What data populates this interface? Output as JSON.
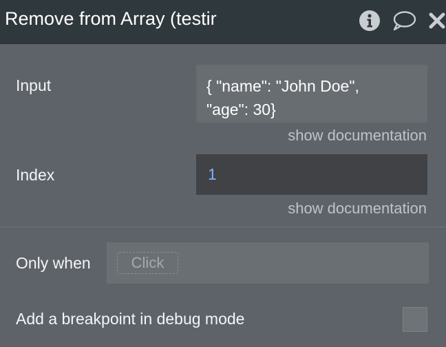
{
  "window": {
    "title": "Remove from Array (testir"
  },
  "icons": {
    "info": "info-icon",
    "comment": "comment-icon",
    "close": "close-icon"
  },
  "fields": {
    "input": {
      "label": "Input",
      "value_line1": "{ \"name\": \"John Doe\",",
      "value_line2": "\"age\": 30}",
      "doc_link": "show documentation"
    },
    "index": {
      "label": "Index",
      "value": "1",
      "doc_link": "show documentation"
    }
  },
  "only_when": {
    "label": "Only when",
    "placeholder_chip": "Click"
  },
  "breakpoint": {
    "label": "Add a breakpoint in debug mode",
    "checked": false
  },
  "colors": {
    "titlebar": "#2f383d",
    "panel": "#5e6369",
    "index_value": "#7fb2ff"
  }
}
